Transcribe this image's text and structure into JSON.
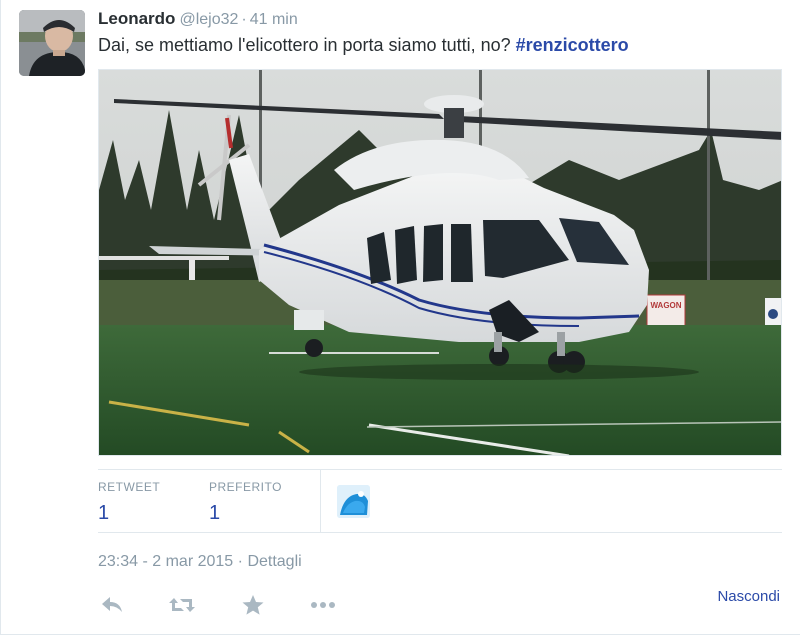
{
  "tweet": {
    "author": {
      "fullname": "Leonardo",
      "username": "@lejo32",
      "time_ago": "41 min",
      "separator": "·"
    },
    "text": {
      "body": "Dai, se mettiamo l'elicottero in porta siamo tutti, no?",
      "hashtag": "#renzicottero"
    },
    "media": {
      "icon": "helicopter-photo",
      "sign_text": "WAGON"
    },
    "stats": {
      "retweet_label": "RETWEET",
      "retweet_count": "1",
      "favorite_label": "PREFERITO",
      "favorite_count": "1"
    },
    "meta": {
      "timestamp": "23:34 - 2 mar 2015",
      "separator": "·",
      "details_link": "Dettagli"
    },
    "actions": {
      "reply_icon": "reply-icon",
      "retweet_icon": "retweet-icon",
      "favorite_icon": "star-icon",
      "more_icon": "more-icon",
      "hide_label": "Nascondi"
    },
    "colors": {
      "link": "#2b4aa8",
      "muted": "#8899a6",
      "text": "#292f33",
      "border": "#e1e8ed"
    }
  }
}
